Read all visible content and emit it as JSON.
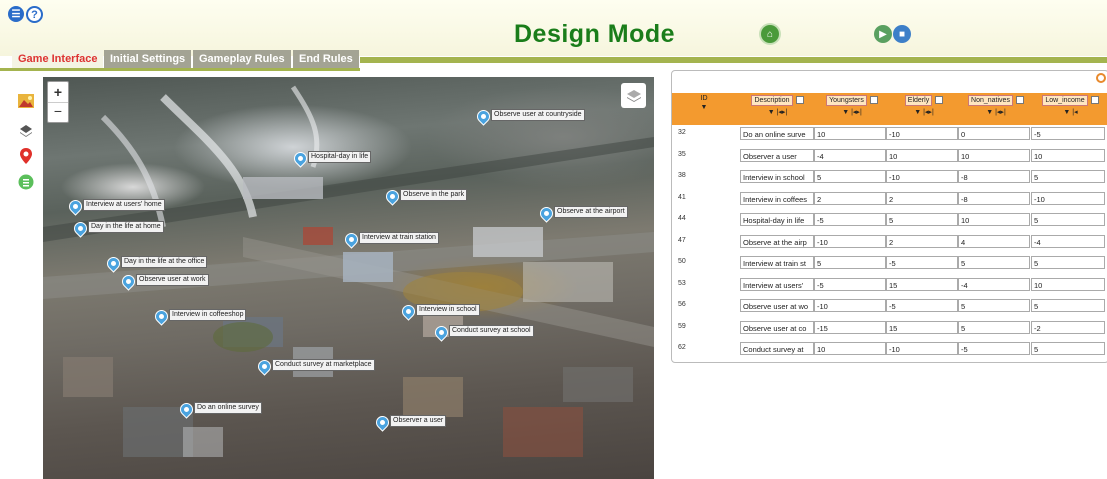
{
  "header": {
    "title": "Design Mode",
    "icons": [
      "menu-icon",
      "help-icon",
      "home-icon",
      "play-icon",
      "save-icon"
    ]
  },
  "tabs": [
    {
      "label": "Game Interface",
      "active": true
    },
    {
      "label": "Initial Settings",
      "active": false
    },
    {
      "label": "Gameplay Rules",
      "active": false
    },
    {
      "label": "End Rules",
      "active": false
    }
  ],
  "tools": [
    "image-icon",
    "layers-icon",
    "location-pin-icon",
    "list-icon"
  ],
  "map": {
    "zoom_in": "+",
    "zoom_out": "−",
    "markers": [
      "Observe user at countryside",
      "Hospital-day in life",
      "Observe in the park",
      "Observe at the airport",
      "Interview at users' home",
      "Day in the life at home",
      "Interview at train station",
      "Day in the life at the office",
      "Observe user at work",
      "Interview in coffeeshop",
      "Interview in school",
      "Conduct survey at school",
      "Conduct survey at marketplace",
      "Do an online survey",
      "Observer a user"
    ]
  },
  "table": {
    "columns": [
      "ID",
      "Description",
      "Youngsters",
      "Elderly",
      "Non_natives",
      "Low_income"
    ],
    "sort_arrows": [
      "▼",
      "▼ |◂▸|",
      "▼ |◂▸|",
      "▼ |◂▸|",
      "▼ |◂▸|",
      "▼ |◂"
    ],
    "rows": [
      {
        "id": "32",
        "desc": "Do an online surve",
        "youngsters": "10",
        "elderly": "-10",
        "non_natives": "0",
        "low_income": "-5"
      },
      {
        "id": "35",
        "desc": "Observer a user",
        "youngsters": "-4",
        "elderly": "10",
        "non_natives": "10",
        "low_income": "10"
      },
      {
        "id": "38",
        "desc": "Interview in school",
        "youngsters": "5",
        "elderly": "-10",
        "non_natives": "-8",
        "low_income": "5"
      },
      {
        "id": "41",
        "desc": "Interview in coffees",
        "youngsters": "2",
        "elderly": "2",
        "non_natives": "-8",
        "low_income": "-10"
      },
      {
        "id": "44",
        "desc": "Hospital-day in life",
        "youngsters": "-5",
        "elderly": "5",
        "non_natives": "10",
        "low_income": "5"
      },
      {
        "id": "47",
        "desc": "Observe at the airp",
        "youngsters": "-10",
        "elderly": "2",
        "non_natives": "4",
        "low_income": "-4"
      },
      {
        "id": "50",
        "desc": "Interview at train st",
        "youngsters": "5",
        "elderly": "-5",
        "non_natives": "5",
        "low_income": "5"
      },
      {
        "id": "53",
        "desc": "Interview at users'",
        "youngsters": "-5",
        "elderly": "15",
        "non_natives": "-4",
        "low_income": "10"
      },
      {
        "id": "56",
        "desc": "Observe user at wo",
        "youngsters": "-10",
        "elderly": "-5",
        "non_natives": "5",
        "low_income": "5"
      },
      {
        "id": "59",
        "desc": "Observe user at co",
        "youngsters": "-15",
        "elderly": "15",
        "non_natives": "5",
        "low_income": "-2"
      },
      {
        "id": "62",
        "desc": "Conduct survey at",
        "youngsters": "10",
        "elderly": "-10",
        "non_natives": "-5",
        "low_income": "5"
      }
    ]
  }
}
